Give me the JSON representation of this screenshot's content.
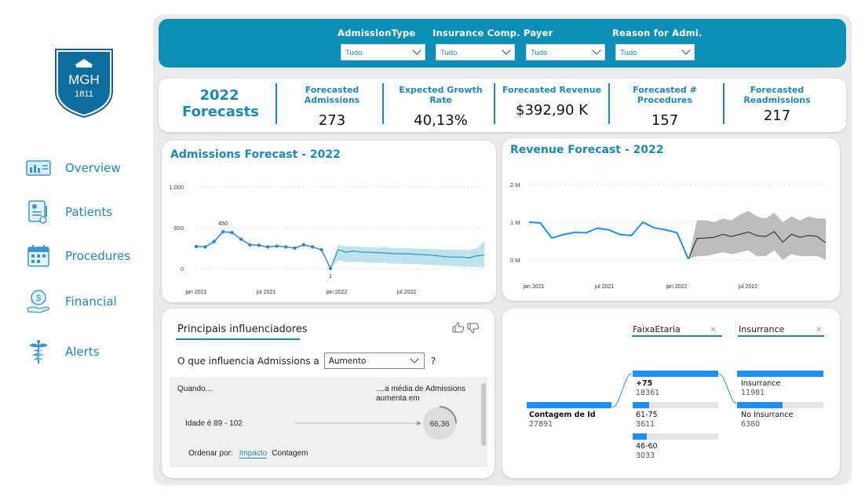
{
  "sidebar": {
    "logo": {
      "initials": "MGH",
      "year": "1811"
    },
    "items": [
      {
        "label": "Overview",
        "icon": "overview-icon"
      },
      {
        "label": "Patients",
        "icon": "patients-icon"
      },
      {
        "label": "Procedures",
        "icon": "procedures-icon"
      },
      {
        "label": "Financial",
        "icon": "financial-icon"
      },
      {
        "label": "Alerts",
        "icon": "alerts-icon"
      }
    ]
  },
  "filters": [
    {
      "label": "AdmissionType",
      "value": "Tudo"
    },
    {
      "label": "Insurance Comp.",
      "value": "Tudo"
    },
    {
      "label": "Payer",
      "value": "Tudo"
    },
    {
      "label": "Reason for Admi.",
      "value": "Tudo"
    }
  ],
  "kpis": {
    "year_line1": "2022",
    "year_line2": "Forecasts",
    "items": [
      {
        "label": "Forecasted Admissions",
        "value": "273"
      },
      {
        "label": "Expected Growth Rate",
        "value": "40,13%"
      },
      {
        "label": "Forecasted Revenue",
        "value": "$392,90 K"
      },
      {
        "label": "Forecasted # Procedures",
        "value": "157"
      },
      {
        "label": "Forecasted Readmissions",
        "value": "217"
      }
    ]
  },
  "chart_data": [
    {
      "type": "line",
      "title": "Admissions Forecast - 2022",
      "ylim": [
        0,
        1000
      ],
      "yticks": [
        "1.000",
        "500",
        "0"
      ],
      "xticks": [
        "jan 2021",
        "jul 2021",
        "jan 2022",
        "jul 2022"
      ],
      "actual": [
        270,
        265,
        330,
        450,
        440,
        360,
        290,
        285,
        265,
        275,
        265,
        250,
        290,
        265,
        230,
        1
      ],
      "forecast": [
        230,
        200,
        215,
        200,
        200,
        195,
        190,
        185,
        180,
        180,
        175,
        170,
        165,
        155,
        145,
        140,
        140,
        130,
        155,
        165
      ],
      "forecast_upper": [
        290,
        270,
        270,
        265,
        260,
        255,
        260,
        255,
        250,
        250,
        245,
        240,
        240,
        235,
        230,
        230,
        230,
        225,
        250,
        330
      ],
      "forecast_lower": [
        100,
        80,
        80,
        80,
        70,
        70,
        70,
        60,
        60,
        55,
        55,
        50,
        45,
        40,
        35,
        30,
        25,
        20,
        20,
        10
      ],
      "data_labels": {
        "peak": "450",
        "min": "1"
      },
      "colors": {
        "actual": "#2f86d6",
        "forecast": "#1f9ab8",
        "band": "#bfe3ec"
      }
    },
    {
      "type": "line",
      "title": "Revenue Forecast - 2022",
      "yticks": [
        "2 M",
        "1 M",
        "0 M"
      ],
      "ylim": [
        0,
        2
      ],
      "xticks": [
        "jan 2021",
        "jul 2021",
        "jan 2022",
        "jul 2022"
      ],
      "actual": [
        1.0,
        0.98,
        0.58,
        0.67,
        0.73,
        0.72,
        0.84,
        0.8,
        0.67,
        0.65,
        1.0,
        0.85,
        0.8,
        0.72,
        0.02
      ],
      "forecast": [
        0.57,
        0.58,
        0.6,
        0.68,
        0.62,
        0.68,
        0.74,
        0.64,
        0.62,
        0.75,
        0.47,
        0.68,
        0.6,
        0.65,
        0.62,
        0.45
      ],
      "forecast_upper": [
        1.05,
        1.05,
        1.0,
        1.1,
        1.05,
        1.2,
        1.3,
        1.15,
        1.1,
        1.25,
        1.0,
        1.15,
        1.05,
        1.15,
        1.1,
        1.1
      ],
      "forecast_lower": [
        0.1,
        0.1,
        0.15,
        0.2,
        0.15,
        0.2,
        0.25,
        0.1,
        0.1,
        0.25,
        0.0,
        0.15,
        0.1,
        0.1,
        0.1,
        0.0
      ],
      "colors": {
        "actual": "#1e90f0",
        "forecast": "#222222",
        "band": "#bdbdbd"
      }
    }
  ],
  "influencers": {
    "title": "Principais influenciadores",
    "question_prefix": "O que influencia Admissions a",
    "question_value": "Aumento",
    "question_suffix": "?",
    "when_label": "Quando...",
    "avg_label_1": "....a média de Admissions",
    "avg_label_2": "aumenta em",
    "factor_label": "Idade é 89 - 102",
    "factor_value": "66,36",
    "sort_label": "Ordenar por:",
    "sort_options": [
      "Impacto",
      "Contagem"
    ]
  },
  "decomp_tree": {
    "headers": [
      "FaixaEtaria",
      "Insurrance"
    ],
    "root": {
      "label": "Contagem de Id",
      "value": "27891"
    },
    "level1": [
      {
        "label": "+75",
        "value": "18361",
        "fraction": 1.0
      },
      {
        "label": "61-75",
        "value": "3611",
        "fraction": 0.197
      },
      {
        "label": "46-60",
        "value": "3033",
        "fraction": 0.165
      }
    ],
    "level2": [
      {
        "label": "Insurrance",
        "value": "11981",
        "fraction": 1.0
      },
      {
        "label": "No Insurrance",
        "value": "6380",
        "fraction": 0.53
      }
    ]
  }
}
